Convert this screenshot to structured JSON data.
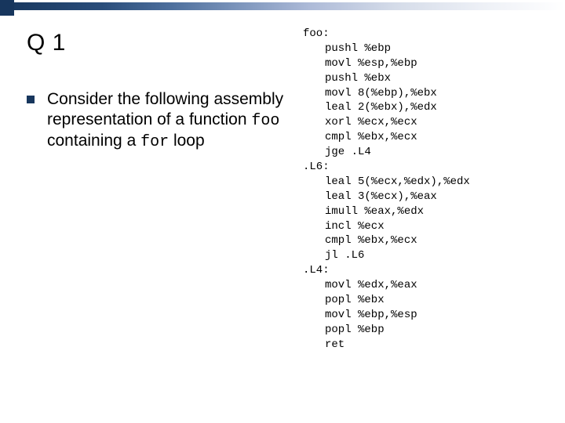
{
  "title": "Q 1",
  "body": {
    "pre_bold": "Consider the following assembly representation of a function ",
    "code1": "foo",
    "mid": " containing a ",
    "code2": "for",
    "post": " loop"
  },
  "asm": [
    {
      "t": "label",
      "s": "foo:"
    },
    {
      "t": "inst",
      "s": "pushl %ebp"
    },
    {
      "t": "inst",
      "s": "movl %esp,%ebp"
    },
    {
      "t": "inst",
      "s": "pushl %ebx"
    },
    {
      "t": "inst",
      "s": "movl 8(%ebp),%ebx"
    },
    {
      "t": "inst",
      "s": "leal 2(%ebx),%edx"
    },
    {
      "t": "inst",
      "s": "xorl %ecx,%ecx"
    },
    {
      "t": "inst",
      "s": "cmpl %ebx,%ecx"
    },
    {
      "t": "inst",
      "s": "jge .L4"
    },
    {
      "t": "label",
      "s": ".L6:"
    },
    {
      "t": "inst",
      "s": "leal 5(%ecx,%edx),%edx"
    },
    {
      "t": "inst",
      "s": "leal 3(%ecx),%eax"
    },
    {
      "t": "inst",
      "s": "imull %eax,%edx"
    },
    {
      "t": "inst",
      "s": "incl %ecx"
    },
    {
      "t": "inst",
      "s": "cmpl %ebx,%ecx"
    },
    {
      "t": "inst",
      "s": "jl .L6"
    },
    {
      "t": "label",
      "s": ".L4:"
    },
    {
      "t": "inst",
      "s": "movl %edx,%eax"
    },
    {
      "t": "inst",
      "s": "popl %ebx"
    },
    {
      "t": "inst",
      "s": "movl %ebp,%esp"
    },
    {
      "t": "inst",
      "s": "popl %ebp"
    },
    {
      "t": "inst",
      "s": "ret"
    }
  ]
}
